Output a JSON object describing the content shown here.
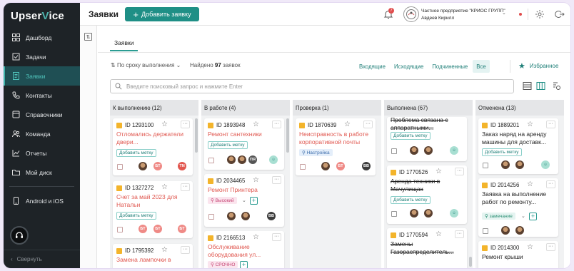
{
  "app": {
    "logo_a": "Upser",
    "logo_b": "V",
    "logo_c": "ice"
  },
  "sidebar": {
    "items": [
      {
        "label": "Дашборд",
        "icon": "dashboard-icon"
      },
      {
        "label": "Задачи",
        "icon": "tasks-icon"
      },
      {
        "label": "Заявки",
        "icon": "requests-icon",
        "active": true
      },
      {
        "label": "Контакты",
        "icon": "contacts-icon"
      },
      {
        "label": "Справочники",
        "icon": "directory-icon"
      },
      {
        "label": "Команда",
        "icon": "team-icon"
      },
      {
        "label": "Отчеты",
        "icon": "reports-icon"
      },
      {
        "label": "Мой диск",
        "icon": "folder-icon"
      }
    ],
    "mobile": {
      "label": "Android и iOS",
      "icon": "phone-icon"
    },
    "collapse_label": "Свернуть"
  },
  "header": {
    "title": "Заявки",
    "add_button": "Добавить заявку",
    "notif_count": "7",
    "org_name": "Частное предприятие \"КРИОС ГРУПП\"",
    "user_name": "Авдеев Кирилл"
  },
  "toolbar": {
    "tab": "Заявки",
    "sort_label": "По сроку выполнения",
    "found_prefix": "Найдено",
    "found_count": "97",
    "found_suffix": "заявок",
    "filters": [
      "Входящие",
      "Исходящие",
      "Подчиненные",
      "Все"
    ],
    "selected_filter": "Все",
    "favorites": "Избранное",
    "search_placeholder": "Введите поисковый запрос и нажмите Enter"
  },
  "columns": [
    {
      "title": "К выполнению (12)",
      "cards": [
        {
          "id": "ID 1293100",
          "title": "Отломались держатели двери...",
          "tag": "Добавить метку"
        },
        {
          "id": "ID 1327272",
          "title": "Счет за май 2023 для Натальи",
          "tag": "Добавить метку"
        },
        {
          "id": "ID 1795392",
          "title": "Замена лампочки в"
        }
      ]
    },
    {
      "title": "В работе (4)",
      "cards": [
        {
          "id": "ID 1893948",
          "title": "Ремонт сантехники",
          "tag": "Добавить метку",
          "avatar": "ПЯ"
        },
        {
          "id": "ID 2034465",
          "title": "Ремонт Принтера",
          "priority": "Высокий",
          "avatar": "BB"
        },
        {
          "id": "ID 2166513",
          "title": "Обслуживание оборудования ул...",
          "priority": "СРОЧНО"
        }
      ]
    },
    {
      "title": "Проверка (1)",
      "cards": [
        {
          "id": "ID 1870639",
          "title": "Неисправность в работе корпоративной почты",
          "priority": "Настройка",
          "avatar_a": "БТ",
          "avatar_b": "BB"
        }
      ]
    },
    {
      "title": "Выполнена (67)",
      "cards": [
        {
          "title": "Проблема связана с аппаратными...",
          "tag": "Добавить метку"
        },
        {
          "id": "ID 1770526",
          "title": "Аренда техники в Мачулищах",
          "tag": "Добавить метку"
        },
        {
          "id": "ID 1770594",
          "title": "Замены Газораспределитель..."
        }
      ]
    },
    {
      "title": "Отменена (13)",
      "cards": [
        {
          "id": "ID 1889201",
          "title": "Заказ наряд на аренду машины для доставк...",
          "tag": "Добавить метку"
        },
        {
          "id": "ID 2014256",
          "title": "Заявка на выполнение работ по ремонту...",
          "priority": "замечание"
        },
        {
          "id": "ID 2014300",
          "title": "Ремонт крыши"
        }
      ]
    }
  ],
  "avatars": {
    "bt": "БТ",
    "tn": "TN"
  },
  "colors": {
    "accent": "#1f8f86",
    "sidebar": "#1e2327",
    "title_red": "#e05850"
  }
}
